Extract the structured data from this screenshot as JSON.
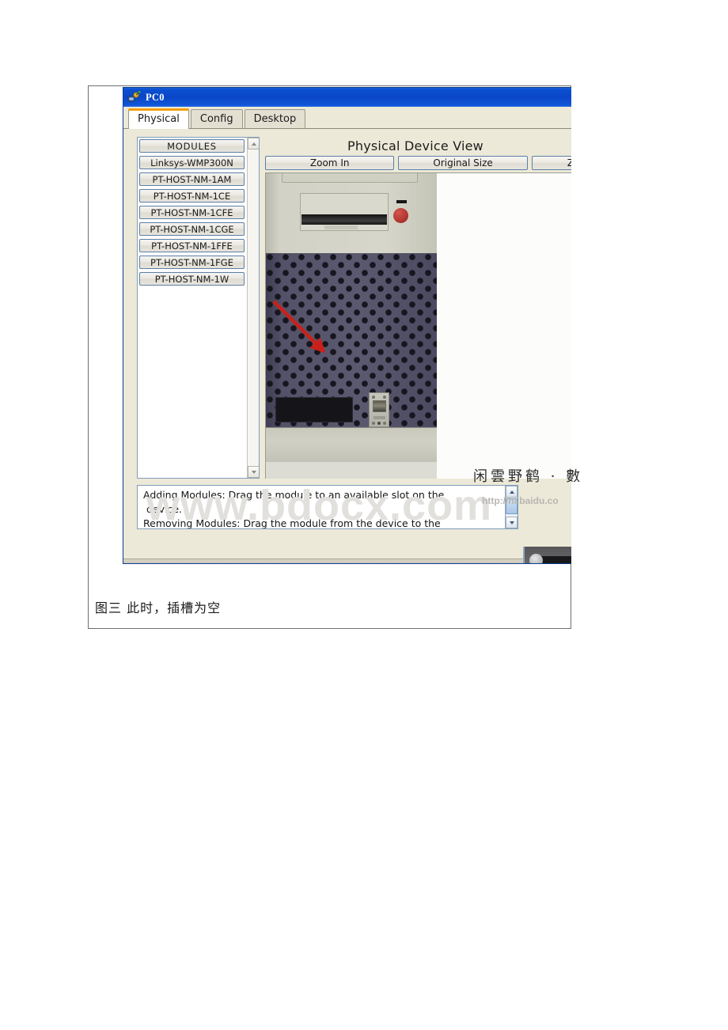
{
  "window": {
    "title": "PC0",
    "icon": "pc-network-icon"
  },
  "tabs": [
    {
      "label": "Physical",
      "active": true
    },
    {
      "label": "Config",
      "active": false
    },
    {
      "label": "Desktop",
      "active": false
    }
  ],
  "modules": {
    "header_label": "MODULES",
    "items": [
      "Linksys-WMP300N",
      "PT-HOST-NM-1AM",
      "PT-HOST-NM-1CE",
      "PT-HOST-NM-1CFE",
      "PT-HOST-NM-1CGE",
      "PT-HOST-NM-1FFE",
      "PT-HOST-NM-1FGE",
      "PT-HOST-NM-1W"
    ]
  },
  "device_view": {
    "title": "Physical Device View",
    "zoom_in_label": "Zoom In",
    "original_size_label": "Original Size",
    "zoom_out_label": "Z"
  },
  "help": {
    "text": "Adding Modules: Drag the module to an available slot on the\n device.\nRemoving Modules: Drag the module from the device to the"
  },
  "watermarks": {
    "site": "www.bdocx.com",
    "url": "http://hi.baidu.co",
    "signature": "闲雲野鹤 · 數"
  },
  "caption": {
    "text": "图三   此时，插槽为空"
  },
  "colors": {
    "titlebar": "#0a46c8",
    "active_tab_accent": "#f3a00e",
    "panel_bg": "#ece9d8",
    "button_border": "#5b7fa6",
    "arrow_red": "#c9211a",
    "grille": "#5b596f"
  }
}
